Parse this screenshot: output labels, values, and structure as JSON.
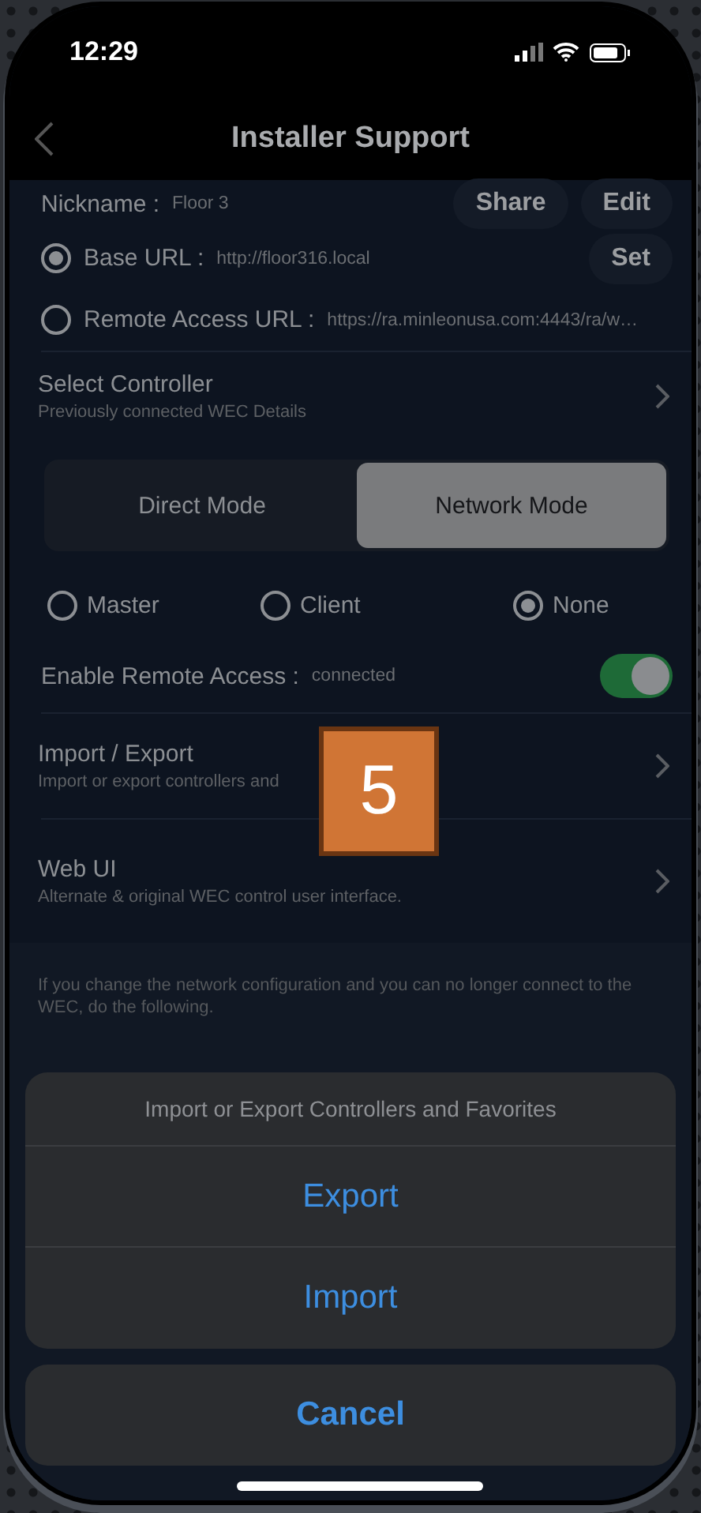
{
  "status_bar": {
    "time": "12:29"
  },
  "nav": {
    "title": "Installer Support"
  },
  "nickname": {
    "label": "Nickname :",
    "value": "Floor 3",
    "buttons": [
      "Share",
      "Edit"
    ]
  },
  "url_options": [
    {
      "label": "Base URL :",
      "value": "http://floor316.local",
      "selected": true,
      "button": "Set"
    },
    {
      "label": "Remote Access URL :",
      "value": "https://ra.minleonusa.com:4443/ra/w…",
      "selected": false
    }
  ],
  "select_controller": {
    "title": "Select Controller",
    "subtitle": "Previously connected WEC Details"
  },
  "modes": [
    {
      "label": "Direct Mode",
      "selected": false
    },
    {
      "label": "Network Mode",
      "selected": true
    }
  ],
  "roles": [
    {
      "label": "Master",
      "selected": false
    },
    {
      "label": "Client",
      "selected": false
    },
    {
      "label": "None",
      "selected": true
    }
  ],
  "remote_access": {
    "label": "Enable Remote Access :",
    "status": "connected",
    "on": true
  },
  "menu_rows": [
    {
      "title": "Import / Export",
      "subtitle": "Import or export controllers and"
    },
    {
      "title": "Web UI",
      "subtitle": "Alternate & original WEC control user interface."
    }
  ],
  "note": "If you change the network configuration and you can no longer connect to the WEC, do the following.",
  "action_sheet": {
    "title": "Import or Export Controllers and Favorites",
    "actions": [
      "Export",
      "Import"
    ],
    "cancel": "Cancel"
  },
  "step_badge": "5"
}
